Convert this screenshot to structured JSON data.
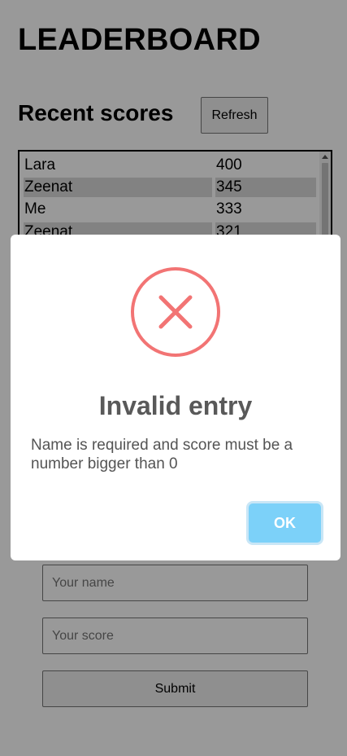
{
  "page": {
    "title": "LEADERBOARD",
    "subtitle": "Recent scores",
    "refresh_label": "Refresh"
  },
  "scores": [
    {
      "name": "Lara",
      "score": "400"
    },
    {
      "name": "Zeenat",
      "score": "345"
    },
    {
      "name": "Me",
      "score": "333"
    },
    {
      "name": "Zeenat",
      "score": "321"
    }
  ],
  "form": {
    "name_placeholder": "Your name",
    "score_placeholder": "Your score",
    "submit_label": "Submit"
  },
  "dialog": {
    "icon": "error-x-icon",
    "icon_color": "#f27474",
    "title": "Invalid entry",
    "text": "Name is required and score must be a number bigger than 0",
    "ok_label": "OK",
    "ok_color": "#7cd1f9"
  }
}
